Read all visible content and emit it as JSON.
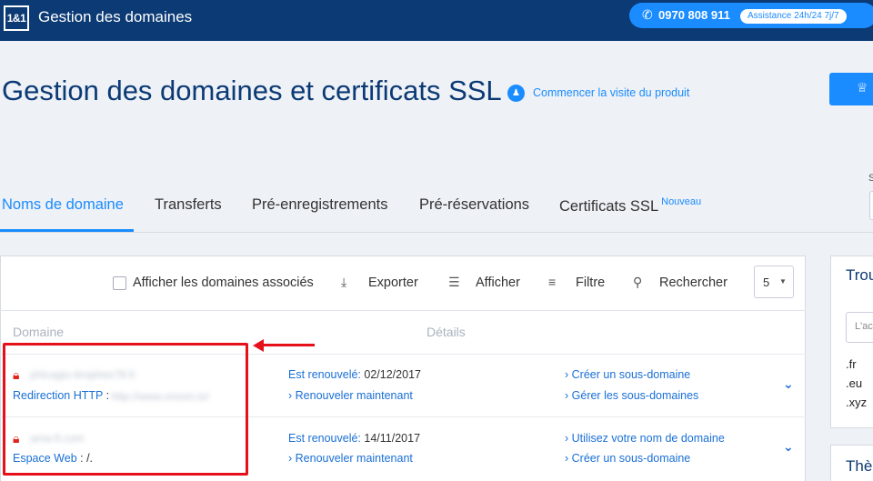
{
  "header": {
    "logo_text": "1&1",
    "app_title": "Gestion des domaines",
    "phone_number": "0970 808 911",
    "assistance_label": "Assistance 24h/24 7j/7"
  },
  "page": {
    "title": "Gestion des domaines et certificats SSL",
    "tour_link": "Commencer la visite du produit",
    "right_label_s": "S"
  },
  "tabs": [
    {
      "label": "Noms de domaine",
      "active": true
    },
    {
      "label": "Transferts"
    },
    {
      "label": "Pré-enregistrements"
    },
    {
      "label": "Pré-réservations"
    },
    {
      "label": "Certificats SSL",
      "badge": "Nouveau"
    }
  ],
  "toolbar": {
    "show_associated_label": "Afficher les domaines associés",
    "export_label": "Exporter",
    "display_label": "Afficher",
    "filter_label": "Filtre",
    "search_label": "Rechercher",
    "page_size": "5"
  },
  "table": {
    "col_domain": "Domaine",
    "col_details": "Détails",
    "rows": [
      {
        "domain": "phicagiu-tirophee78.fr",
        "target_label": "Redirection HTTP",
        "target_value": "http://www.onoon.io/",
        "renew_label": "Est renouvelé:",
        "renew_date": "02/12/2017",
        "renew_now": "Renouveler maintenant",
        "action1": "Créer un sous-domaine",
        "action2": "Gérer les sous-domaines"
      },
      {
        "domain": "ama-fi.com",
        "target_label": "Espace Web",
        "target_value": "/.",
        "renew_label": "Est renouvelé:",
        "renew_date": "14/11/2017",
        "renew_now": "Renouveler maintenant",
        "action1": "Utilisez votre nom de domaine",
        "action2": "Créer un sous-domaine"
      }
    ]
  },
  "sidebar": {
    "card1_title": "Trou",
    "card1_placeholder": "L'ac",
    "tlds": [
      ".fr",
      ".eu",
      ".xyz"
    ],
    "card2_title": "Thè"
  },
  "colors": {
    "brand_dark": "#0b3a75",
    "accent": "#1a8cff",
    "link": "#1a6fd6",
    "highlight_red": "#e5101a"
  }
}
